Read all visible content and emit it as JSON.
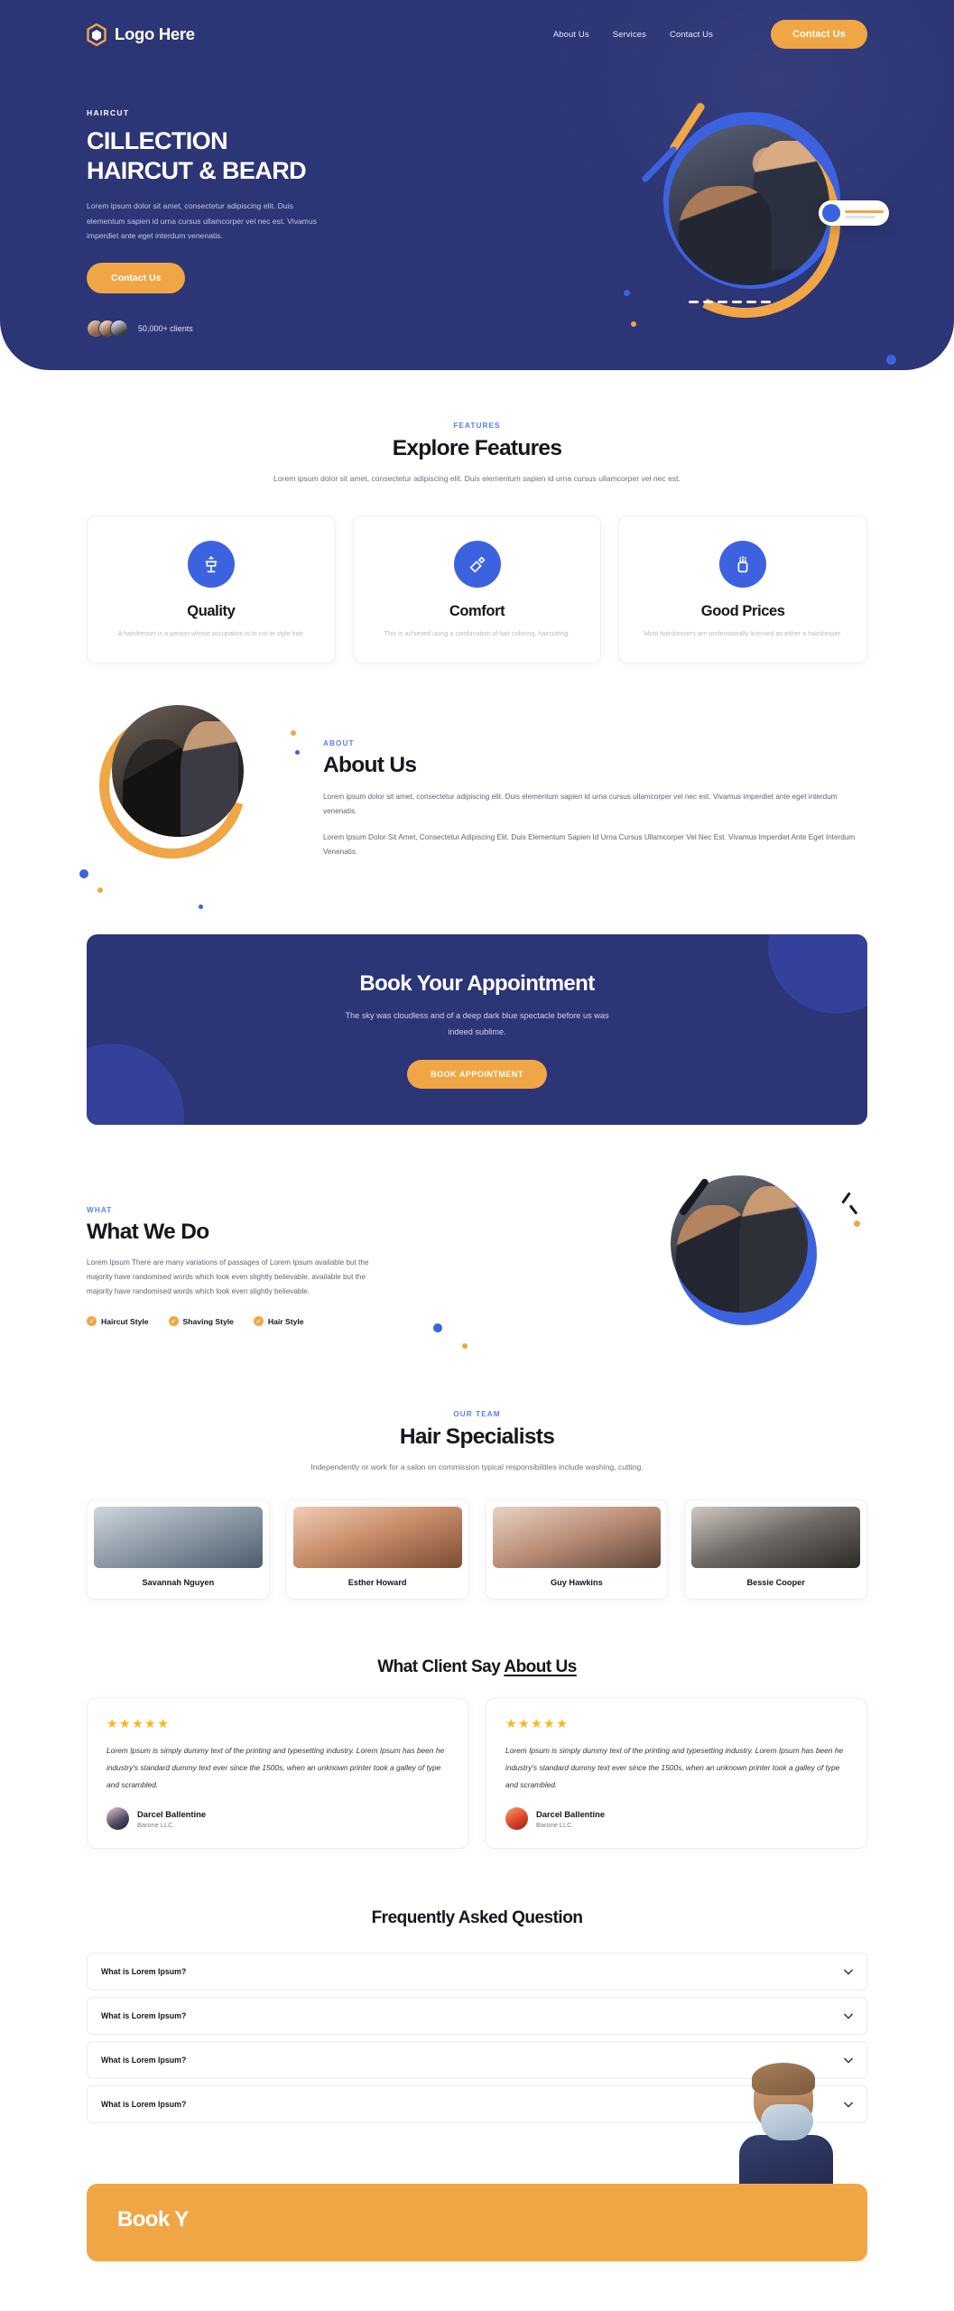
{
  "nav": {
    "brand": "Logo Here",
    "links": [
      "About Us",
      "Services",
      "Contact Us"
    ],
    "cta": "Contact Us"
  },
  "hero": {
    "eyebrow": "HAIRCUT",
    "title_line1": "CILLECTION",
    "title_line2": "HAIRCUT & BEARD",
    "paragraph": "Lorem ipsum dolor sit amet, consectetur adipiscing elit. Duis elementum sapien id urna cursus ullamcorper vel nec est. Vivamus imperdiet ante eget interdum venenatis.",
    "cta": "Contact Us",
    "clients_label": "50,000+ clients"
  },
  "features": {
    "eyebrow": "FEATURES",
    "title": "Explore Features",
    "lede": "Lorem ipsum dolor sit amet, consectetur adipiscing elit. Duis elementum sapien id urna cursus ullamcorper vel nec est.",
    "cards": [
      {
        "icon": "barber-chair-icon",
        "title": "Quality",
        "desc": "A hairdresser is a person whose occupation is to cut or style hair."
      },
      {
        "icon": "razor-icon",
        "title": "Comfort",
        "desc": "This is achieved using a combination of hair coloring, haircutting."
      },
      {
        "icon": "clipper-icon",
        "title": "Good Prices",
        "desc": "Most hairdressers are professionally licensed as either a hairdresser."
      }
    ]
  },
  "about": {
    "eyebrow": "ABOUT",
    "title": "About Us",
    "paragraph1": "Lorem ipsum dolor sit amet, consectetur adipiscing elit. Duis elementum sapien id urna cursus ullamcorper vel nec est. Vivamus imperdiet ante eget interdum venenatis.",
    "paragraph2": "Lorem Ipsum Dolor Sit Amet, Consectetur Adipiscing Elit. Duis Elementum Sapien Id Urna Cursus Ullamcorper Vel Nec Est. Vivamus Imperdiet Ante Eget Interdum Venenatis."
  },
  "book": {
    "title": "Book Your Appointment",
    "subtitle": "The sky was cloudless and of a deep dark blue spectacle before us was indeed sublime.",
    "cta": "BOOK APPOINTMENT"
  },
  "whatwedo": {
    "eyebrow": "WHAT",
    "title": "What We Do",
    "paragraph": "Lorem Ipsum There are many variations of passages of Lorem Ipsum available but the majority have randomised words which look even slightly believable. available but the majority have randomised words which look even slightly believable.",
    "tags": [
      "Haircut Style",
      "Shaving Style",
      "Hair Style"
    ]
  },
  "team": {
    "eyebrow": "OUR TEAM",
    "title": "Hair Specialists",
    "lede": "Independently or work for a salon on commission typical responsibilities include washing, cutting.",
    "members": [
      {
        "name": "Savannah Nguyen"
      },
      {
        "name": "Esther Howard"
      },
      {
        "name": "Guy Hawkins"
      },
      {
        "name": "Bessie Cooper"
      }
    ]
  },
  "testimonials": {
    "title_plain": "What Client Say ",
    "title_underline": "About Us",
    "stars": "★★★★★",
    "items": [
      {
        "quote": "Lorem Ipsum is simply dummy text of the printing and typesetting industry. Lorem Ipsum has been he industry's standard dummy text ever since the 1500s, when an unknown printer took a galley of type and scrambled.",
        "name": "Darcel Ballentine",
        "org": "Barone LLC."
      },
      {
        "quote": "Lorem Ipsum is simply dummy text of the printing and typesetting industry. Lorem Ipsum has been he industry's standard dummy text ever since the 1500s, when an unknown printer took a galley of type and scrambled.",
        "name": "Darcel Ballentine",
        "org": "Barone LLC."
      }
    ]
  },
  "faq": {
    "title": "Frequently Asked Question",
    "items": [
      {
        "question": "What is Lorem Ipsum?"
      },
      {
        "question": "What is Lorem Ipsum?"
      },
      {
        "question": "What is Lorem Ipsum?"
      },
      {
        "question": "What is Lorem Ipsum?"
      }
    ]
  },
  "footer_cta": {
    "title": "Book Y"
  },
  "colors": {
    "navy": "#2c3575",
    "orange": "#f0a645",
    "blue": "#3d62e0",
    "accent_text": "#5b7cf5",
    "star": "#fdb515"
  }
}
